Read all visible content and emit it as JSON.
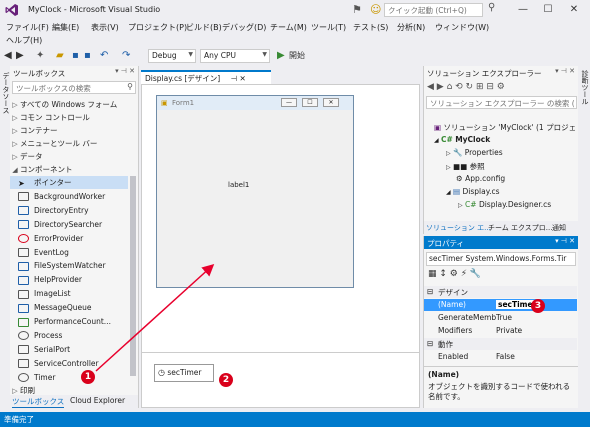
{
  "window": {
    "title": "MyClock - Microsoft Visual Studio",
    "quick_launch_placeholder": "クイック起動 (Ctrl+Q)"
  },
  "menu": [
    "ファイル(F)",
    "編集(E)",
    "表示(V)",
    "プロジェクト(P)",
    "ビルド(B)",
    "デバッグ(D)",
    "チーム(M)",
    "ツール(T)",
    "テスト(S)",
    "分析(N)",
    "ウィンドウ(W)",
    "ヘルプ(H)"
  ],
  "toolbar": {
    "config": "Debug",
    "platform": "Any CPU",
    "start_label": "開始"
  },
  "left_rail": {
    "label": "データソース"
  },
  "right_rail": {
    "label": "診断ツール"
  },
  "toolbox": {
    "title": "ツールボックス",
    "search_placeholder": "ツールボックスの検索",
    "items": [
      {
        "glyph": "▷",
        "label": "すべての Windows フォーム"
      },
      {
        "glyph": "▷",
        "label": "コモン コントロール"
      },
      {
        "glyph": "▷",
        "label": "コンテナー"
      },
      {
        "glyph": "▷",
        "label": "メニューとツール バー"
      },
      {
        "glyph": "▷",
        "label": "データ"
      },
      {
        "glyph": "◢",
        "label": "コンポーネント"
      }
    ],
    "components": [
      {
        "icon": "pointer",
        "label": "ポインター",
        "selected": true
      },
      {
        "icon": "backgroundworker",
        "label": "BackgroundWorker"
      },
      {
        "icon": "directoryentry",
        "label": "DirectoryEntry"
      },
      {
        "icon": "directorysearcher",
        "label": "DirectorySearcher"
      },
      {
        "icon": "errorprovider",
        "label": "ErrorProvider"
      },
      {
        "icon": "eventlog",
        "label": "EventLog"
      },
      {
        "icon": "filesystemwatcher",
        "label": "FileSystemWatcher"
      },
      {
        "icon": "helpprovider",
        "label": "HelpProvider"
      },
      {
        "icon": "imagelist",
        "label": "ImageList"
      },
      {
        "icon": "messagequeue",
        "label": "MessageQueue"
      },
      {
        "icon": "performancecounter",
        "label": "PerformanceCount..."
      },
      {
        "icon": "process",
        "label": "Process"
      },
      {
        "icon": "serialport",
        "label": "SerialPort"
      },
      {
        "icon": "servicecontroller",
        "label": "ServiceController"
      },
      {
        "icon": "timer",
        "label": "Timer"
      }
    ],
    "truncated_item": {
      "glyph": "▷",
      "label": "印刷"
    },
    "bottom_tabs": [
      "ツールボックス",
      "Cloud Explorer"
    ]
  },
  "designer": {
    "tab_label": "Display.cs [デザイン]",
    "form_title": "Form1",
    "label_text": "label1",
    "tray_component": "secTimer"
  },
  "solution_explorer": {
    "title": "ソリューション エクスプローラー",
    "search_placeholder": "ソリューション エクスプローラー の検索 (",
    "tree": [
      {
        "label": "ソリューション 'MyClock' (1 プロジェ"
      },
      {
        "label": "MyClock"
      },
      {
        "label": "Properties"
      },
      {
        "label": "参照"
      },
      {
        "label": "App.config"
      },
      {
        "label": "Display.cs"
      },
      {
        "label": "Display.Designer.cs"
      }
    ],
    "tabs": [
      "ソリューション エ...",
      "チーム エクスプロ...",
      "通知"
    ]
  },
  "properties": {
    "title": "プロパティ",
    "object": "secTimer  System.Windows.Forms.Tir",
    "categories": [
      {
        "name": "デザイン",
        "rows": [
          {
            "name": "(Name)",
            "value": "secTimer"
          },
          {
            "name": "GenerateMemb",
            "value": "True"
          },
          {
            "name": "Modifiers",
            "value": "Private"
          }
        ]
      },
      {
        "name": "動作",
        "rows": [
          {
            "name": "Enabled",
            "value": "False"
          }
        ]
      }
    ],
    "desc_title": "(Name)",
    "desc_text": "オブジェクトを識別するコードで使われる名前です。"
  },
  "annotations": [
    "1",
    "2",
    "3"
  ],
  "status": {
    "text": "準備完了"
  },
  "colors": {
    "accent": "#007acc",
    "badge": "#d9001b",
    "arrow": "#e8002d"
  }
}
